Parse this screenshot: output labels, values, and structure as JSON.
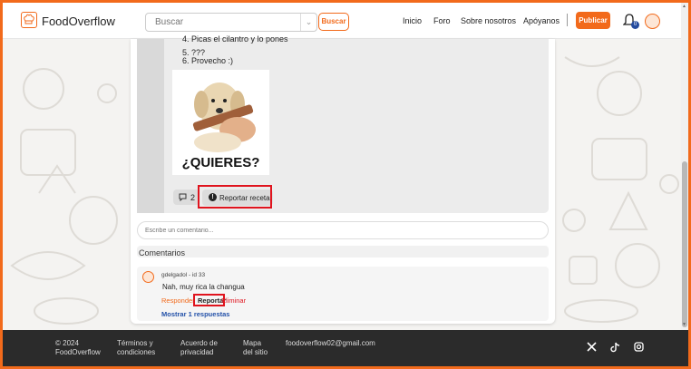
{
  "header": {
    "brand": "FoodOverflow",
    "search_placeholder": "Buscar",
    "search_button": "Buscar",
    "nav": [
      "Inicio",
      "Foro",
      "Sobre nosotros",
      "Apóyanos"
    ],
    "publish_button": "Publicar",
    "notification_count": "0",
    "icons": {
      "logo": "chef-hat-icon",
      "bell": "bell-icon",
      "chevron": "chevron-down-icon"
    }
  },
  "post": {
    "steps_cut": "4. Picas el cilantro y lo pones",
    "steps": [
      "5. ???",
      "6. Provecho :)"
    ],
    "meme_caption": "¿QUIERES?",
    "comment_count": "2",
    "report_recipe": "Reportar receta"
  },
  "comments": {
    "input_placeholder": "Escribe un comentario...",
    "title": "Comentarios",
    "items": [
      {
        "user": "gdelgadol - id 33",
        "text": "Nah, muy rica la changua",
        "reply": "Responder",
        "report": "Reportar",
        "delete": "Eliminar",
        "show_replies": "Mostrar 1 respuestas"
      }
    ]
  },
  "footer": {
    "copyright": [
      "© 2024",
      "FoodOverflow"
    ],
    "terms": [
      "Términos y",
      "condiciones"
    ],
    "privacy": [
      "Acuerdo de",
      "privacidad"
    ],
    "sitemap": [
      "Mapa",
      "del sitio"
    ],
    "email": "foodoverflow02@gmail.com",
    "social": [
      "x-icon",
      "tiktok-icon",
      "instagram-icon"
    ]
  },
  "colors": {
    "accent": "#f26a1b",
    "highlight": "#e0141e",
    "link": "#2250a8",
    "footer": "#2b2b2b"
  }
}
